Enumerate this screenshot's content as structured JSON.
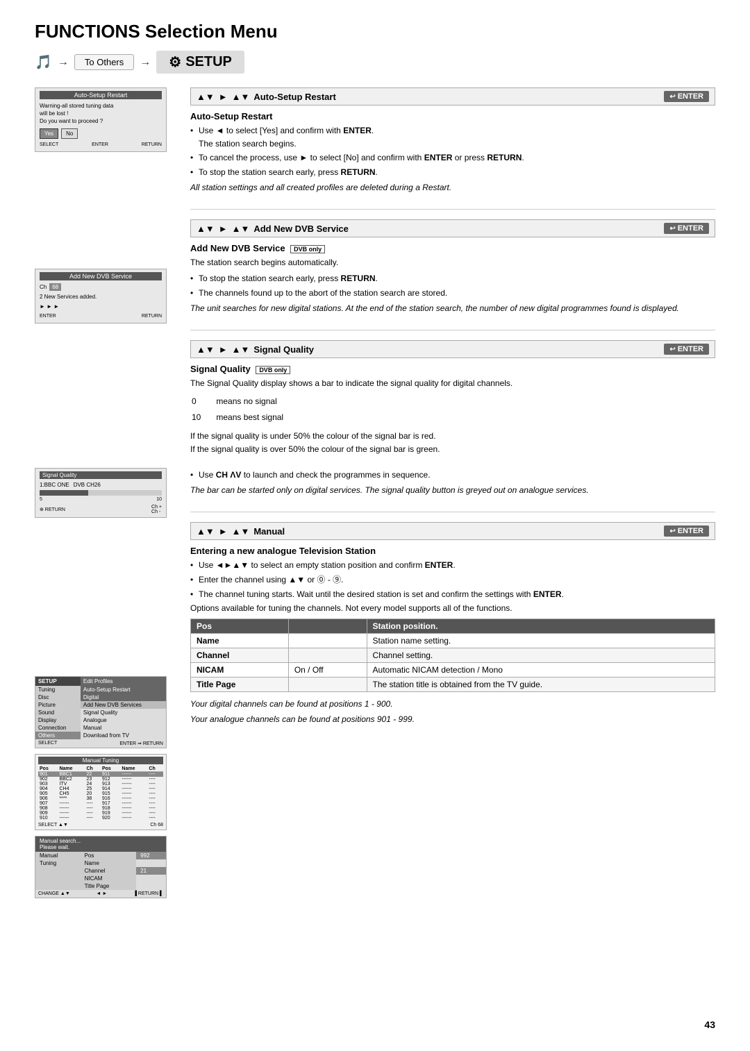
{
  "page": {
    "title": "FUNCTIONS Selection Menu",
    "page_number": "43"
  },
  "breadcrumb": {
    "icon": "🎵",
    "to_others": "To Others",
    "arrow": "→",
    "setup_icon": "⚙",
    "setup_label": "SETUP"
  },
  "sections": [
    {
      "id": "auto_setup_restart",
      "nav": {
        "arrows": "▲▼",
        "triangle": "►",
        "arrows2": "▲▼",
        "label": "Auto-Setup Restart",
        "enter": "ENTER"
      },
      "screen": {
        "title": "Auto-Setup Restart",
        "warning": "Warning-all stored tuning data",
        "warning2": "will be lost !",
        "question": "Do you want to proceed ?",
        "yes": "Yes",
        "no": "No"
      },
      "content_title": "Auto-Setup Restart",
      "bullets": [
        "Use ◄ to select [Yes] and confirm with ENTER.",
        "The station search begins.",
        "To cancel the process, use ► to select [No] and confirm with ENTER or press RETURN.",
        "To stop the station search early, press RETURN."
      ],
      "italic": "All station settings and all created profiles are deleted during a Restart."
    },
    {
      "id": "add_new_dvb",
      "nav": {
        "arrows": "▲▼",
        "triangle": "►",
        "arrows2": "▲▼",
        "label": "Add New DVB Service",
        "enter": "ENTER"
      },
      "screen": {
        "title": "Add New DVB Service",
        "ch_label": "Ch",
        "ch_value": "68",
        "added": "2 New Services added.",
        "arrows": "► ► ►"
      },
      "content_title": "Add New DVB Service",
      "dvb_badge": "DVB only",
      "desc": "The station search begins automatically.",
      "bullets": [
        "To stop the station search early, press RETURN.",
        "The channels found up to the abort of the station search are stored."
      ],
      "italic": "The unit searches for new digital stations. At the end of the station search, the number of new digital programmes found is displayed."
    },
    {
      "id": "signal_quality",
      "nav": {
        "arrows": "▲▼",
        "triangle": "►",
        "arrows2": "▲▼",
        "label": "Signal Quality",
        "enter": "ENTER"
      },
      "screen": {
        "title": "Signal Quality",
        "channel_label": "1:BBC ONE",
        "dvb_label": "DVB CH26",
        "bar_label": "5",
        "bar_max": "10",
        "ch_plus": "Ch +",
        "ch_minus": "Ch -"
      },
      "content_title": "Signal Quality",
      "dvb_badge": "DVB only",
      "desc": "The Signal Quality display shows a bar to indicate the signal quality for digital channels.",
      "quality_rows": [
        {
          "value": "0",
          "desc": "means no signal"
        },
        {
          "value": "10",
          "desc": "means best signal"
        }
      ],
      "lines": [
        "If the signal quality is under 50% the colour of the signal bar is red.",
        "If the signal quality is over 50% the colour of the signal bar is green."
      ],
      "bullet_ch": "Use CH ΛV to launch and check the programmes in sequence.",
      "italic": "The bar can be started only on digital services. The signal quality button is greyed out on analogue services."
    },
    {
      "id": "manual",
      "nav": {
        "arrows": "▲▼",
        "triangle": "►",
        "arrows2": "▲▼",
        "label": "Manual",
        "enter": "ENTER"
      },
      "setup_menu": {
        "header": "SETUP",
        "items_left": [
          "Tuning",
          "Disc",
          "Picture",
          "Sound",
          "Display",
          "Connection",
          "Others"
        ],
        "items_right_header": "Edit Profiles",
        "items_right": [
          "Auto-Setup Restart",
          "Digital",
          "Add New DVB Services",
          "Signal Quality",
          "Analogue",
          "Manual",
          "Download from TV"
        ]
      },
      "tuning_table": {
        "title": "Manual Tuning",
        "headers": [
          "Pos",
          "Name",
          "Ch",
          "Pos",
          "Name",
          "Ch"
        ],
        "rows": [
          [
            "901",
            "BBC1",
            "22",
            "911",
            "------",
            "----"
          ],
          [
            "902",
            "BBC2",
            "23",
            "912",
            "------",
            "----"
          ],
          [
            "903",
            "ITV",
            "24",
            "913",
            "------",
            "----"
          ],
          [
            "904",
            "CH4",
            "25",
            "914",
            "------",
            "----"
          ],
          [
            "905",
            "CH5",
            "20",
            "915",
            "------",
            "----"
          ],
          [
            "906",
            "****",
            "38",
            "916",
            "------",
            "----"
          ],
          [
            "907",
            "------",
            "----",
            "917",
            "------",
            "----"
          ],
          [
            "908",
            "------",
            "----",
            "918",
            "------",
            "----"
          ],
          [
            "909",
            "------",
            "----",
            "919",
            "------",
            "----"
          ],
          [
            "910",
            "------",
            "----",
            "920",
            "------",
            "----"
          ]
        ]
      },
      "content_title": "Entering a new analogue Television Station",
      "bullets": [
        "Use ◄►▲▼ to select an empty station position and confirm ENTER.",
        "Enter the channel using ▲▼ or ⓪ - ⑨.",
        "The channel tuning starts. Wait until the desired station is set and confirm the settings with ENTER."
      ],
      "options_note": "Options available for tuning the channels. Not every model supports all of the functions.",
      "options_table": {
        "headers": [
          "Pos",
          "",
          "Station position."
        ],
        "rows": [
          {
            "col1": "Pos",
            "col2": "",
            "col3": "Station position."
          },
          {
            "col1": "Name",
            "col2": "",
            "col3": "Station name setting."
          },
          {
            "col1": "Channel",
            "col2": "",
            "col3": "Channel setting."
          },
          {
            "col1": "NICAM",
            "col2": "On / Off",
            "col3": "Automatic NICAM detection / Mono"
          },
          {
            "col1": "Title Page",
            "col2": "",
            "col3": "The station title is obtained from the TV guide."
          }
        ]
      },
      "digital_positions": "Your digital channels can be found at positions 1 - 900.",
      "analogue_positions": "Your analogue channels can be found at positions 901 - 999.",
      "manual_search": {
        "title": "Manual search...",
        "subtitle": "Please wait.",
        "rows": [
          {
            "left": "Manual",
            "right": "Pos",
            "right_val": "992"
          },
          {
            "left": "Tuning",
            "right": "Name",
            "right_val": ""
          },
          {
            "left": "",
            "right": "Channel",
            "right_val": "21"
          },
          {
            "left": "",
            "right": "NICAM",
            "right_val": ""
          },
          {
            "left": "",
            "right": "Title Page",
            "right_val": ""
          }
        ]
      }
    }
  ]
}
